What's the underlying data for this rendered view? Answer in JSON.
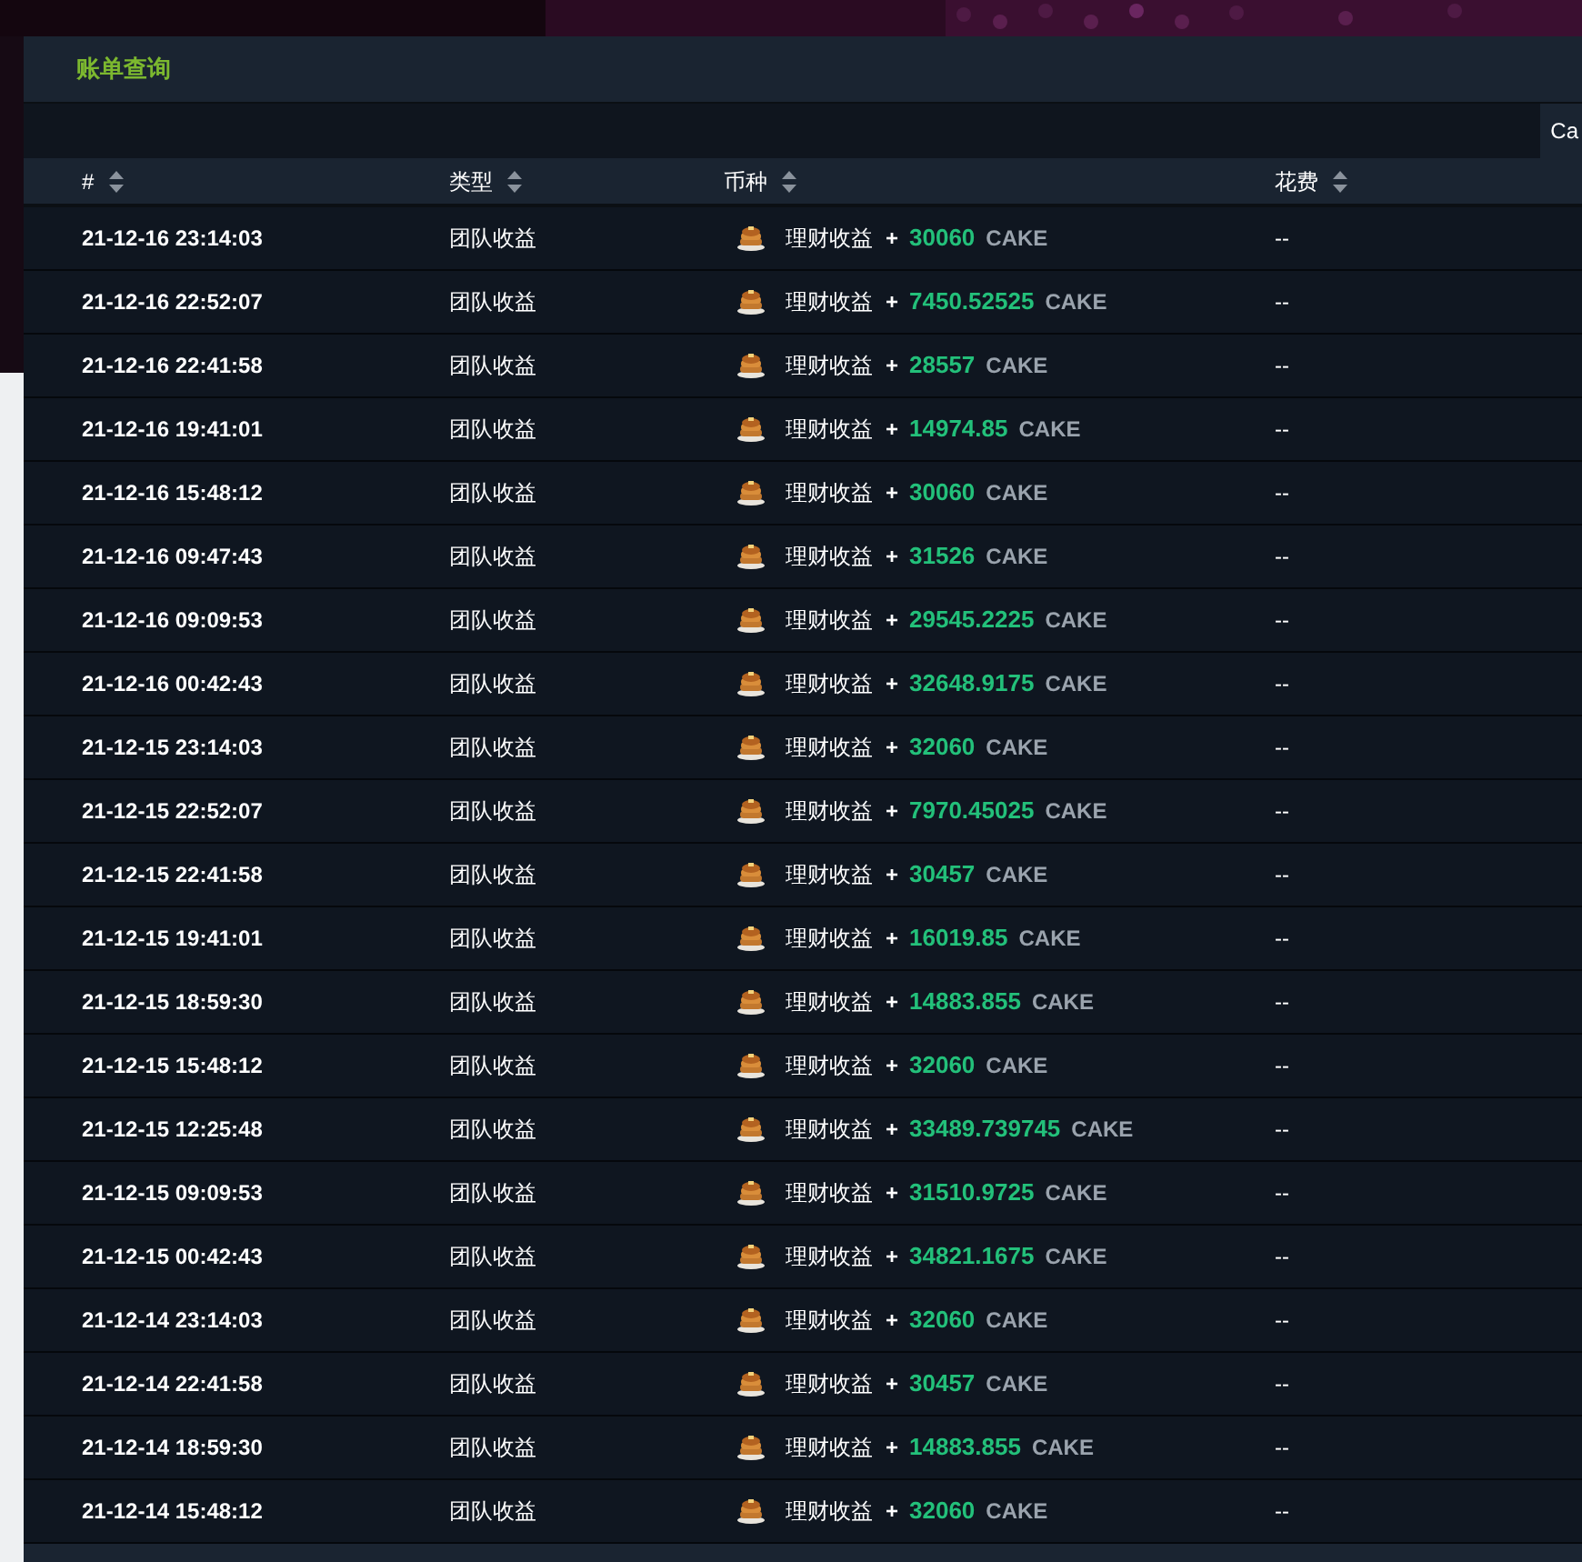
{
  "title": "账单查询",
  "toolbar": {
    "button": "Ca"
  },
  "columns": [
    {
      "label": "#"
    },
    {
      "label": "类型"
    },
    {
      "label": "币种"
    },
    {
      "label": "花费"
    }
  ],
  "rows": [
    {
      "time": "21-12-16 23:14:03",
      "type": "团队收益",
      "label": "理财收益",
      "sign": "+",
      "amount": "30060",
      "currency": "CAKE",
      "fee": "--"
    },
    {
      "time": "21-12-16 22:52:07",
      "type": "团队收益",
      "label": "理财收益",
      "sign": "+",
      "amount": "7450.52525",
      "currency": "CAKE",
      "fee": "--"
    },
    {
      "time": "21-12-16 22:41:58",
      "type": "团队收益",
      "label": "理财收益",
      "sign": "+",
      "amount": "28557",
      "currency": "CAKE",
      "fee": "--"
    },
    {
      "time": "21-12-16 19:41:01",
      "type": "团队收益",
      "label": "理财收益",
      "sign": "+",
      "amount": "14974.85",
      "currency": "CAKE",
      "fee": "--"
    },
    {
      "time": "21-12-16 15:48:12",
      "type": "团队收益",
      "label": "理财收益",
      "sign": "+",
      "amount": "30060",
      "currency": "CAKE",
      "fee": "--"
    },
    {
      "time": "21-12-16 09:47:43",
      "type": "团队收益",
      "label": "理财收益",
      "sign": "+",
      "amount": "31526",
      "currency": "CAKE",
      "fee": "--"
    },
    {
      "time": "21-12-16 09:09:53",
      "type": "团队收益",
      "label": "理财收益",
      "sign": "+",
      "amount": "29545.2225",
      "currency": "CAKE",
      "fee": "--"
    },
    {
      "time": "21-12-16 00:42:43",
      "type": "团队收益",
      "label": "理财收益",
      "sign": "+",
      "amount": "32648.9175",
      "currency": "CAKE",
      "fee": "--"
    },
    {
      "time": "21-12-15 23:14:03",
      "type": "团队收益",
      "label": "理财收益",
      "sign": "+",
      "amount": "32060",
      "currency": "CAKE",
      "fee": "--"
    },
    {
      "time": "21-12-15 22:52:07",
      "type": "团队收益",
      "label": "理财收益",
      "sign": "+",
      "amount": "7970.45025",
      "currency": "CAKE",
      "fee": "--"
    },
    {
      "time": "21-12-15 22:41:58",
      "type": "团队收益",
      "label": "理财收益",
      "sign": "+",
      "amount": "30457",
      "currency": "CAKE",
      "fee": "--"
    },
    {
      "time": "21-12-15 19:41:01",
      "type": "团队收益",
      "label": "理财收益",
      "sign": "+",
      "amount": "16019.85",
      "currency": "CAKE",
      "fee": "--"
    },
    {
      "time": "21-12-15 18:59:30",
      "type": "团队收益",
      "label": "理财收益",
      "sign": "+",
      "amount": "14883.855",
      "currency": "CAKE",
      "fee": "--"
    },
    {
      "time": "21-12-15 15:48:12",
      "type": "团队收益",
      "label": "理财收益",
      "sign": "+",
      "amount": "32060",
      "currency": "CAKE",
      "fee": "--"
    },
    {
      "time": "21-12-15 12:25:48",
      "type": "团队收益",
      "label": "理财收益",
      "sign": "+",
      "amount": "33489.739745",
      "currency": "CAKE",
      "fee": "--"
    },
    {
      "time": "21-12-15 09:09:53",
      "type": "团队收益",
      "label": "理财收益",
      "sign": "+",
      "amount": "31510.9725",
      "currency": "CAKE",
      "fee": "--"
    },
    {
      "time": "21-12-15 00:42:43",
      "type": "团队收益",
      "label": "理财收益",
      "sign": "+",
      "amount": "34821.1675",
      "currency": "CAKE",
      "fee": "--"
    },
    {
      "time": "21-12-14 23:14:03",
      "type": "团队收益",
      "label": "理财收益",
      "sign": "+",
      "amount": "32060",
      "currency": "CAKE",
      "fee": "--"
    },
    {
      "time": "21-12-14 22:41:58",
      "type": "团队收益",
      "label": "理财收益",
      "sign": "+",
      "amount": "30457",
      "currency": "CAKE",
      "fee": "--"
    },
    {
      "time": "21-12-14 18:59:30",
      "type": "团队收益",
      "label": "理财收益",
      "sign": "+",
      "amount": "14883.855",
      "currency": "CAKE",
      "fee": "--"
    },
    {
      "time": "21-12-14 15:48:12",
      "type": "团队收益",
      "label": "理财收益",
      "sign": "+",
      "amount": "32060",
      "currency": "CAKE",
      "fee": "--"
    }
  ]
}
